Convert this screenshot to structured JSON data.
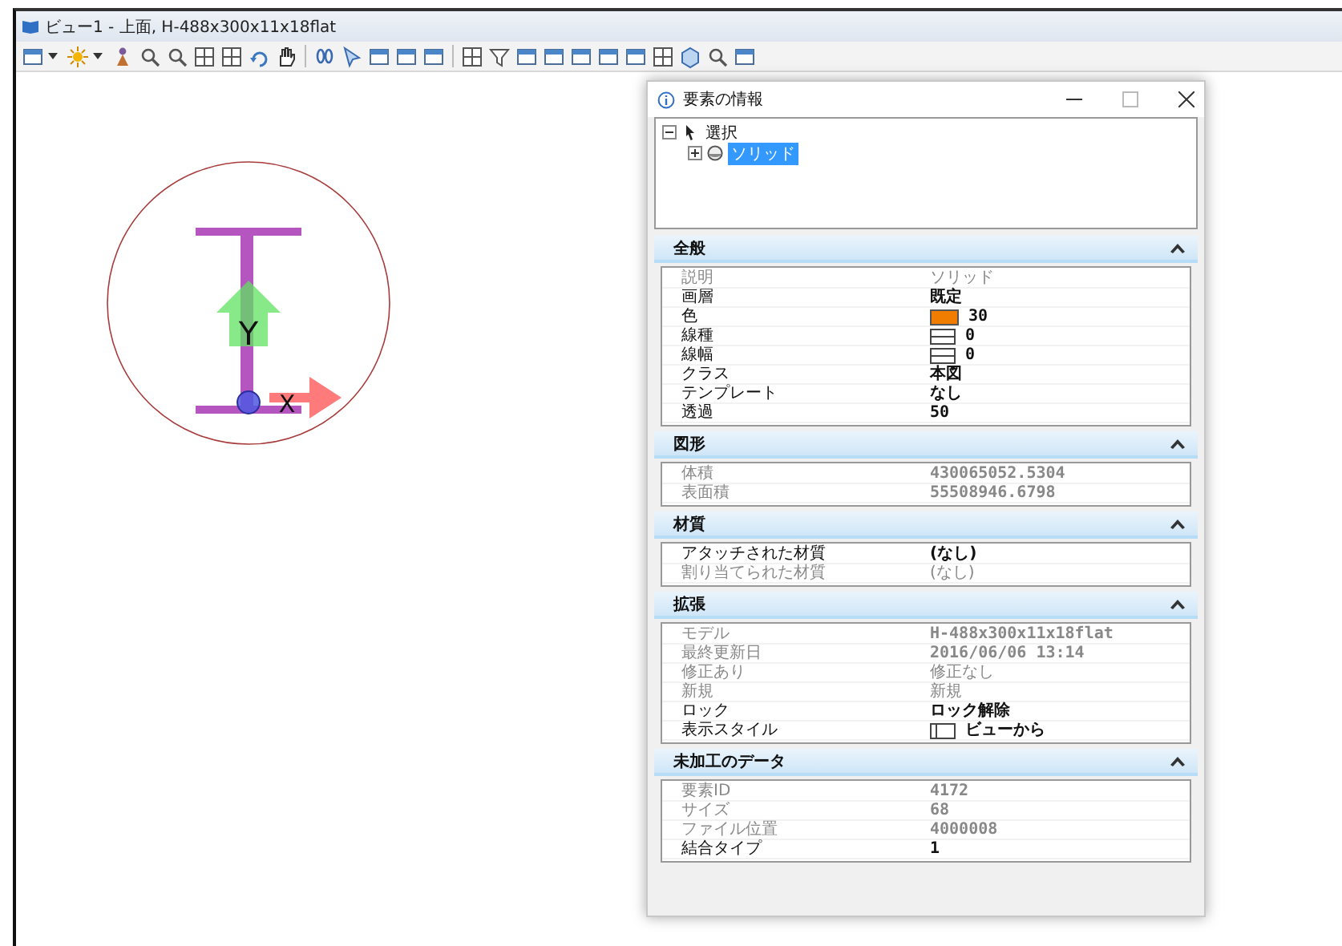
{
  "window": {
    "title": "ビュー1 - 上面, H-488x300x11x18flat"
  },
  "canvas": {
    "axis_labels": [
      "Y",
      "X"
    ]
  },
  "panel": {
    "title": "要素の情報",
    "tree": [
      {
        "label": "選択",
        "expanded": true,
        "selected": false,
        "children": [
          {
            "label": "ソリッド",
            "expanded": false,
            "selected": true
          }
        ]
      }
    ],
    "sections": [
      {
        "title": "全般",
        "expanded": true,
        "rows": [
          {
            "label": "説明",
            "value": "ソリッド",
            "readonly": true,
            "kind": "text"
          },
          {
            "label": "画層",
            "value": "既定",
            "readonly": false,
            "kind": "text"
          },
          {
            "label": "色",
            "value": "30",
            "readonly": false,
            "kind": "color",
            "color": "#f07d00"
          },
          {
            "label": "線種",
            "value": "0",
            "readonly": false,
            "kind": "linestyle"
          },
          {
            "label": "線幅",
            "value": "0",
            "readonly": false,
            "kind": "linestyle"
          },
          {
            "label": "クラス",
            "value": "本図",
            "readonly": false,
            "kind": "text"
          },
          {
            "label": "テンプレート",
            "value": "なし",
            "readonly": false,
            "kind": "text"
          },
          {
            "label": "透過",
            "value": "50",
            "readonly": false,
            "kind": "text"
          }
        ]
      },
      {
        "title": "図形",
        "expanded": true,
        "rows": [
          {
            "label": "体積",
            "value": "430065052.5304",
            "readonly": true,
            "kind": "text"
          },
          {
            "label": "表面積",
            "value": "55508946.6798",
            "readonly": true,
            "kind": "text"
          }
        ]
      },
      {
        "title": "材質",
        "expanded": true,
        "rows": [
          {
            "label": "アタッチされた材質",
            "value": "(なし)",
            "readonly": false,
            "kind": "text"
          },
          {
            "label": "割り当てられた材質",
            "value": "(なし)",
            "readonly": true,
            "kind": "text"
          }
        ]
      },
      {
        "title": "拡張",
        "expanded": true,
        "rows": [
          {
            "label": "モデル",
            "value": "H-488x300x11x18flat",
            "readonly": true,
            "kind": "text"
          },
          {
            "label": "最終更新日",
            "value": "2016/06/06 13:14",
            "readonly": true,
            "kind": "text"
          },
          {
            "label": "修正あり",
            "value": "修正なし",
            "readonly": true,
            "kind": "text"
          },
          {
            "label": "新規",
            "value": "新規",
            "readonly": true,
            "kind": "text"
          },
          {
            "label": "ロック",
            "value": "ロック解除",
            "readonly": false,
            "kind": "text"
          },
          {
            "label": "表示スタイル",
            "value": "ビューから",
            "readonly": false,
            "kind": "view"
          }
        ]
      },
      {
        "title": "未加工のデータ",
        "expanded": true,
        "rows": [
          {
            "label": "要素ID",
            "value": "4172",
            "readonly": true,
            "kind": "text"
          },
          {
            "label": "サイズ",
            "value": "68",
            "readonly": true,
            "kind": "text"
          },
          {
            "label": "ファイル位置",
            "value": "4000008",
            "readonly": true,
            "kind": "text"
          },
          {
            "label": "結合タイプ",
            "value": "1",
            "readonly": false,
            "kind": "text"
          }
        ]
      }
    ]
  }
}
